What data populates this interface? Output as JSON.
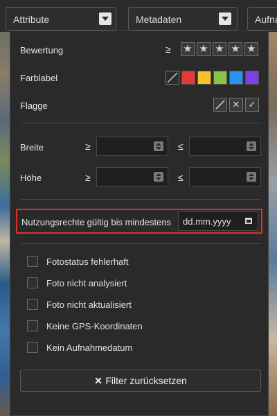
{
  "filters": {
    "attribute": "Attribute",
    "metadata": "Metadaten",
    "recording": "Aufna"
  },
  "panel": {
    "rating": {
      "label": "Bewertung",
      "op": "≥",
      "stars": [
        "★",
        "★",
        "★",
        "★",
        "★"
      ]
    },
    "color_label": {
      "label": "Farblabel",
      "colors": [
        "#2b2b2b",
        "#e53935",
        "#fbc02d",
        "#8bc34a",
        "#2196f3",
        "#7e3fe8"
      ]
    },
    "flag": {
      "label": "Flagge",
      "icons": [
        "⌀",
        "✕",
        "✓"
      ]
    },
    "width": {
      "label": "Breite",
      "op_min": "≥",
      "op_max": "≤"
    },
    "height": {
      "label": "Höhe",
      "op_min": "≥",
      "op_max": "≤"
    },
    "usage_rights": {
      "label": "Nutzungsrechte gültig bis mindestens",
      "placeholder": "dd.mm.yyyy"
    },
    "checks": [
      "Fotostatus fehlerhaft",
      "Foto nicht analysiert",
      "Foto nicht aktualisiert",
      "Keine GPS-Koordinaten",
      "Kein Aufnahmedatum"
    ],
    "reset": {
      "icon": "✕",
      "label": "Filter zurücksetzen"
    }
  }
}
